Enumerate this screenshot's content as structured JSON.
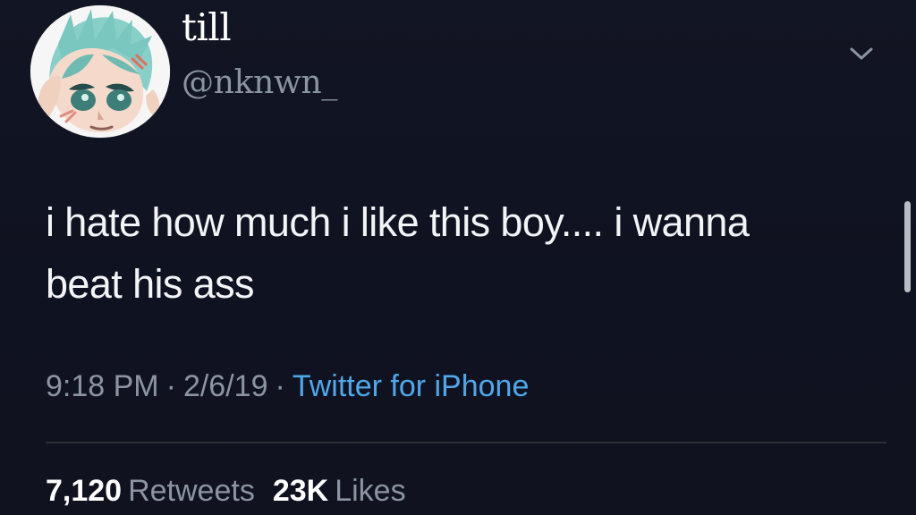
{
  "user": {
    "display_name": "till",
    "handle": "@nknwn_",
    "avatar_icon": "anime-avatar-icon"
  },
  "tweet": {
    "text": "i hate how much i like this boy.... i wanna\nbeat his ass",
    "time": "9:18 PM",
    "separator": "·",
    "date": "2/6/19",
    "source": "Twitter for iPhone"
  },
  "stats": {
    "retweets_count": "7,120",
    "retweets_label": "Retweets",
    "likes_count": "23K",
    "likes_label": "Likes"
  },
  "icons": {
    "menu": "chevron-down-icon"
  },
  "colors": {
    "background": "#10131f",
    "text": "#f2f4f6",
    "secondary_text": "#8b95a1",
    "link": "#4ea8ea",
    "divider": "#293038"
  }
}
